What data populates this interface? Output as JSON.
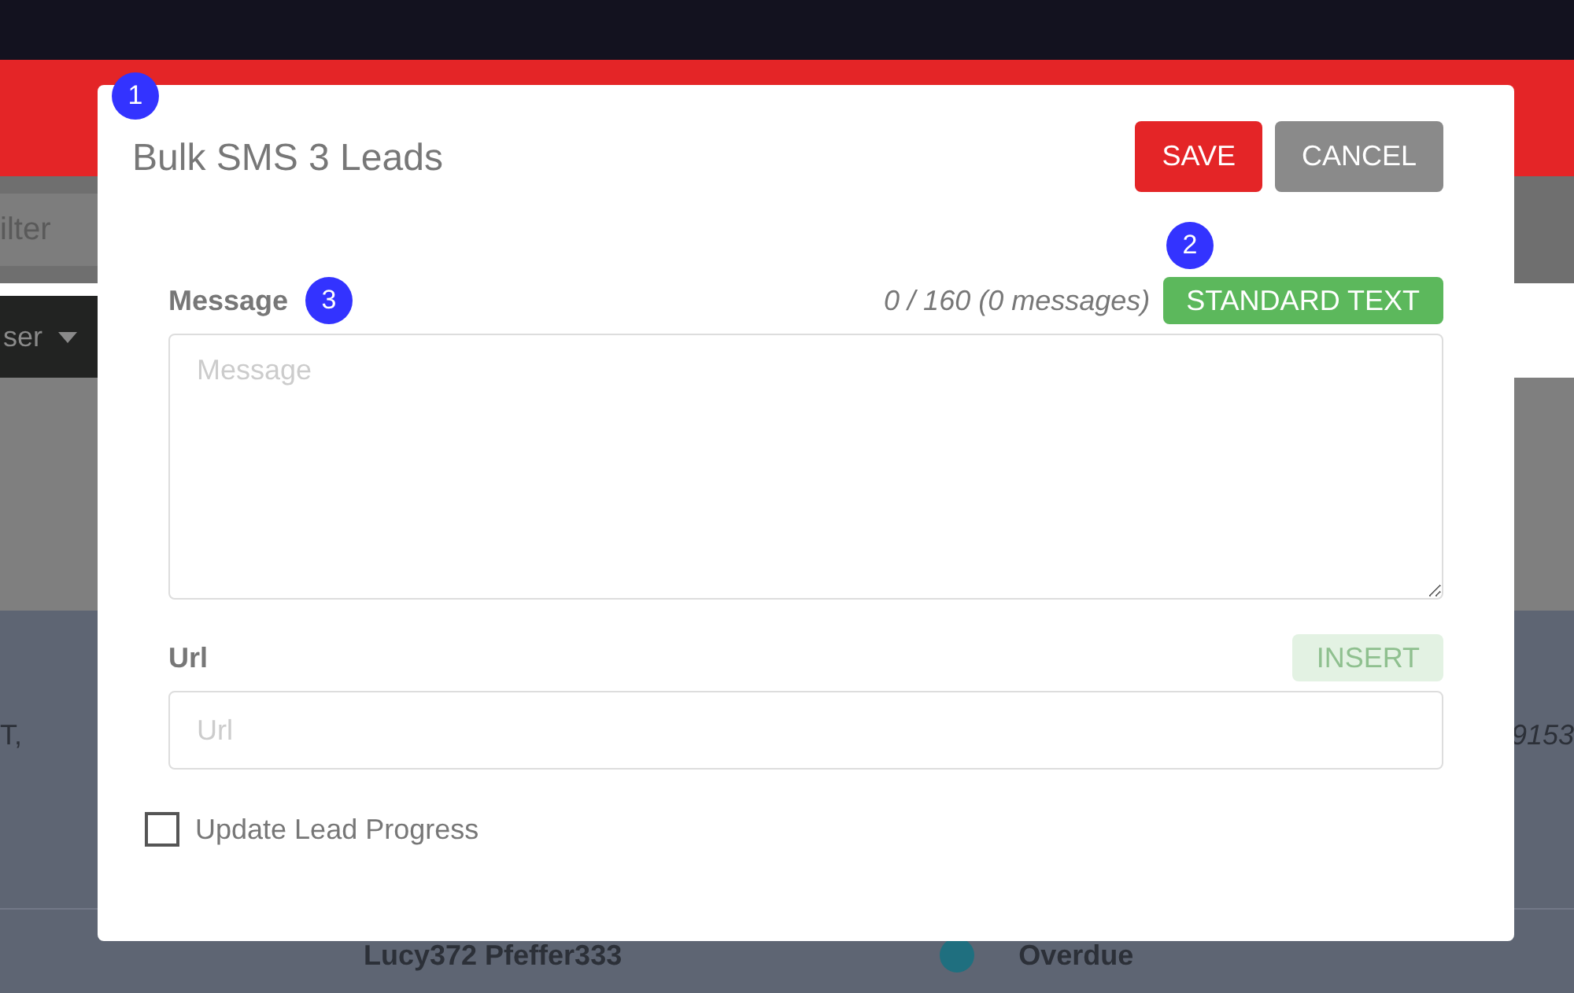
{
  "background": {
    "filter_placeholder": "ilter",
    "user_dropdown": "ser",
    "row_text": "T,",
    "row_number": "9153",
    "lead_name": "Lucy372 Pfeffer333",
    "lead_status": "Overdue"
  },
  "dialog": {
    "title": "Bulk SMS 3 Leads",
    "buttons": [
      {
        "label": "SAVE",
        "kind": "primary"
      },
      {
        "label": "CANCEL",
        "kind": "secondary"
      }
    ],
    "message": {
      "label": "Message",
      "counter": "0 / 160 (0 messages)",
      "action": "STANDARD TEXT",
      "action_disabled": false,
      "placeholder": "Message"
    },
    "url": {
      "label": "Url",
      "action": "INSERT",
      "action_disabled": true,
      "placeholder": "Url"
    },
    "update_progress": {
      "label": "Update Lead Progress",
      "checked": false
    }
  },
  "markers": [
    "1",
    "2",
    "3"
  ]
}
